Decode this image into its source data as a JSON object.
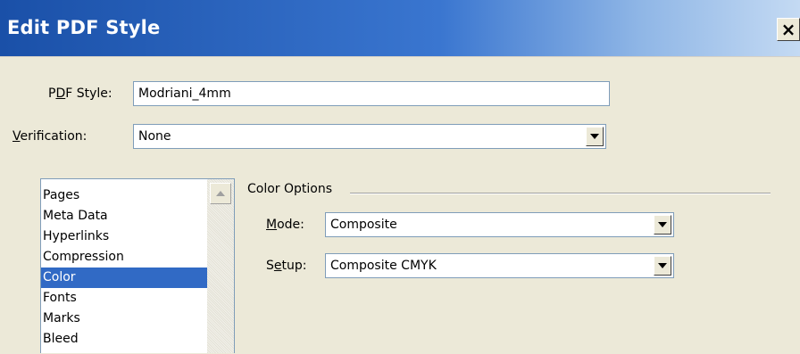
{
  "window": {
    "title": "Edit PDF Style",
    "close_glyph": "×"
  },
  "form": {
    "pdf_style_label_pre": "P",
    "pdf_style_label_ul": "D",
    "pdf_style_label_post": "F Style:",
    "pdf_style_value": "Modriani_4mm",
    "verification_label_ul": "V",
    "verification_label_post": "erification:",
    "verification_value": "None"
  },
  "list": {
    "items": [
      "Pages",
      "Meta Data",
      "Hyperlinks",
      "Compression",
      "Color",
      "Fonts",
      "Marks",
      "Bleed"
    ],
    "selected_index": 4
  },
  "color_options": {
    "group_title": "Color Options",
    "mode_label_ul": "M",
    "mode_label_post": "ode:",
    "mode_value": "Composite",
    "setup_label_pre": "S",
    "setup_label_ul": "e",
    "setup_label_post": "tup:",
    "setup_value": "Composite CMYK"
  },
  "icons": {
    "close": "close-icon",
    "dropdown": "chevron-down-icon",
    "scroll_up": "scroll-up-icon"
  }
}
